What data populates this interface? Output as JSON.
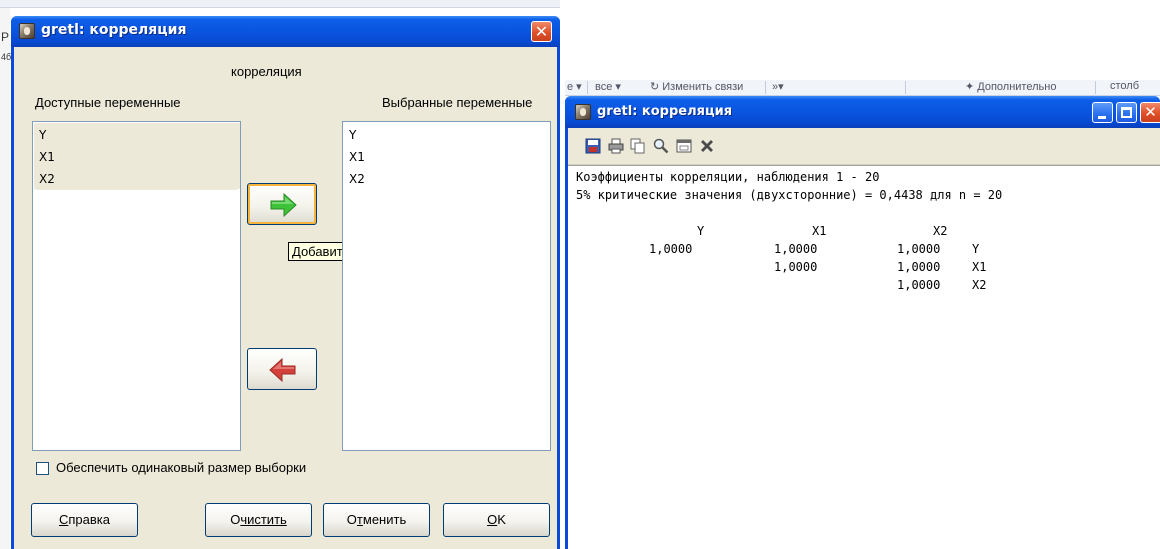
{
  "background": {
    "frag_p": "P",
    "frag_4": "4б",
    "ribbon": {
      "item1": "е ▾",
      "item2": "все ▾",
      "item3": "↻ Изменить связи",
      "item4": "»▾",
      "item5": "✦ Дополнительно",
      "item6": "столб"
    }
  },
  "dialog": {
    "title": "gretl: корреляция",
    "heading": "корреляция",
    "available_label": "Доступные переменные",
    "selected_label": "Выбранные переменные",
    "available_items": [
      "Y",
      "X1",
      "X2"
    ],
    "selected_items": [
      "Y",
      "X1",
      "X2"
    ],
    "tooltip": "Добавить",
    "checkbox_label": "Обеспечить одинаковый размер выборки",
    "checkbox_checked": false,
    "buttons": {
      "help_first": "С",
      "help_rest": "правка",
      "clear_first": "О",
      "clear_rest": "чистить",
      "cancel_first": "О",
      "cancel_ul": "т",
      "cancel_rest": "менить",
      "ok_first": "O",
      "ok_rest": "K"
    },
    "colors": {
      "add_arrow": "#3ec23a",
      "remove_arrow": "#d3403a"
    }
  },
  "output": {
    "title": "gretl: корреляция",
    "line1": "Коэффициенты корреляции, наблюдения 1 - 20",
    "line2": "5% критические значения (двухсторонние) = 0,4438 для n = 20",
    "col_headers": [
      "Y",
      "X1",
      "X2"
    ],
    "rows": [
      {
        "cells": [
          "1,0000",
          "1,0000",
          "1,0000"
        ],
        "label": "Y"
      },
      {
        "cells": [
          "",
          "1,0000",
          "1,0000"
        ],
        "label": "X1"
      },
      {
        "cells": [
          "",
          "",
          "1,0000"
        ],
        "label": "X2"
      }
    ],
    "toolbar_icons": [
      "save-icon",
      "print-icon",
      "copy-icon",
      "find-icon",
      "window-icon",
      "close-icon"
    ]
  }
}
